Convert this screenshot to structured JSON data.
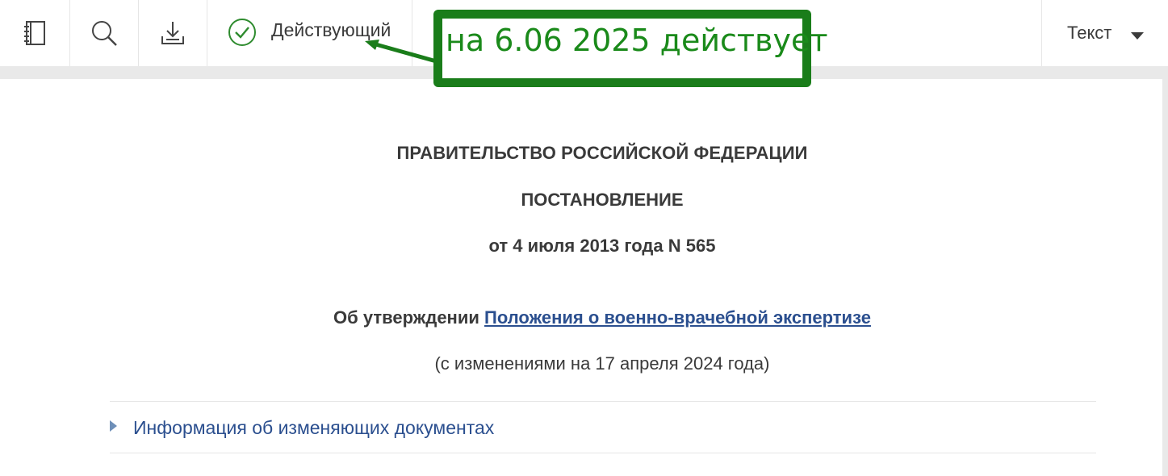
{
  "toolbar": {
    "buttons": [
      {
        "name": "contents",
        "icon": "notebook-icon"
      },
      {
        "name": "search",
        "icon": "search-icon"
      },
      {
        "name": "download",
        "icon": "download-icon"
      }
    ],
    "status": {
      "icon": "check-circle-icon",
      "label": "Действующий",
      "color": "#2e8b2e"
    },
    "view_select": {
      "label": "Текст",
      "icon": "caret-down-icon"
    }
  },
  "annotation": {
    "text": "на 6.06 2025 действует",
    "color": "#1a7d1a"
  },
  "document": {
    "authority": "ПРАВИТЕЛЬСТВО РОССИЙСКОЙ ФЕДЕРАЦИИ",
    "doc_type": "ПОСТАНОВЛЕНИЕ",
    "date_number": "от 4 июля 2013 года N 565",
    "title_prefix": "Об утверждении",
    "title_link": "Положения о военно-врачебной экспертизе",
    "revision": "(с изменениями на 17 апреля 2024 года)",
    "changes_info": "Информация об изменяющих документах",
    "link_color": "#2b4f8f"
  }
}
